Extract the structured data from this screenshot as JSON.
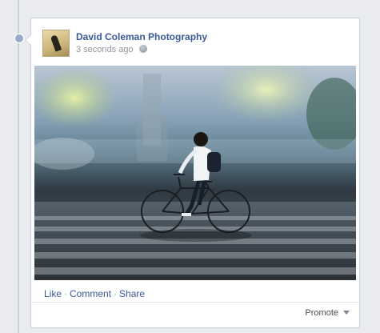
{
  "post": {
    "author": "David Coleman Photography",
    "timestamp": "3 seconds ago",
    "privacy_icon": "globe-icon",
    "photo_subject": "cyclist-on-bicycle",
    "actions": {
      "like": "Like",
      "separator": "·",
      "comment": "Comment",
      "share": "Share"
    },
    "promote": {
      "label": "Promote",
      "icon": "chevron-down-icon"
    }
  },
  "colors": {
    "link": "#3b5998",
    "meta": "#90949c",
    "border": "#c4cde0",
    "background": "#e9ebee"
  }
}
